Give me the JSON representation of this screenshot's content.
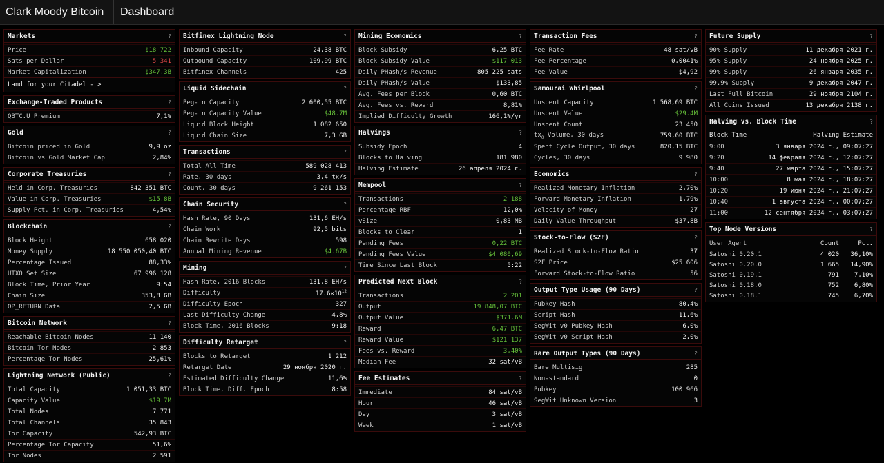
{
  "header": {
    "brand": "Clark Moody Bitcoin",
    "page_title": "Dashboard"
  },
  "columns": [
    [
      {
        "id": "markets",
        "title": "Markets",
        "rows": [
          {
            "k": "Price",
            "v": "$18 722",
            "c": "pos"
          },
          {
            "k": "Sats per Dollar",
            "v": "5 341",
            "c": "neg"
          },
          {
            "k": "Market Capitalization",
            "v": "$347.3B",
            "c": "pos"
          }
        ],
        "link": "Land for your Citadel - >"
      },
      {
        "id": "etp",
        "title": "Exchange-Traded Products",
        "rows": [
          {
            "k": "QBTC.U Premium",
            "v": "7,1%"
          }
        ]
      },
      {
        "id": "gold",
        "title": "Gold",
        "rows": [
          {
            "k": "Bitcoin priced in Gold",
            "v": "9,9 oz"
          },
          {
            "k": "Bitcoin vs Gold Market Cap",
            "v": "2,84%"
          }
        ]
      },
      {
        "id": "corp",
        "title": "Corporate Treasuries",
        "rows": [
          {
            "k": "Held in Corp. Treasuries",
            "v": "842 351 BTC"
          },
          {
            "k": "Value in Corp. Treasuries",
            "v": "$15.8B",
            "c": "pos"
          },
          {
            "k": "Supply Pct. in Corp. Treasuries",
            "v": "4,54%"
          }
        ]
      },
      {
        "id": "blockchain",
        "title": "Blockchain",
        "rows": [
          {
            "k": "Block Height",
            "v": "658 020"
          },
          {
            "k": "Money Supply",
            "v": "18 550 050,40 BTC"
          },
          {
            "k": "Percentage Issued",
            "v": "88,33%"
          },
          {
            "k": "UTXO Set Size",
            "v": "67 996 128"
          },
          {
            "k": "Block Time, Prior Year",
            "v": "9:54"
          },
          {
            "k": "Chain Size",
            "v": "353,8 GB"
          },
          {
            "k": "OP_RETURN Data",
            "v": "2,5 GB"
          }
        ]
      },
      {
        "id": "network",
        "title": "Bitcoin Network",
        "rows": [
          {
            "k": "Reachable Bitcoin Nodes",
            "v": "11 140"
          },
          {
            "k": "Bitcoin Tor Nodes",
            "v": "2 853"
          },
          {
            "k": "Percentage Tor Nodes",
            "v": "25,61%"
          }
        ]
      },
      {
        "id": "lightning",
        "title": "Lightning Network (Public)",
        "rows": [
          {
            "k": "Total Capacity",
            "v": "1 051,33 BTC"
          },
          {
            "k": "Capacity Value",
            "v": "$19.7M",
            "c": "pos"
          },
          {
            "k": "Total Nodes",
            "v": "7 771"
          },
          {
            "k": "Total Channels",
            "v": "35 843"
          },
          {
            "k": "Tor Capacity",
            "v": "542,93 BTC"
          },
          {
            "k": "Percentage Tor Capacity",
            "v": "51,6%"
          },
          {
            "k": "Tor Nodes",
            "v": "2 591"
          }
        ]
      }
    ],
    [
      {
        "id": "bitfinex",
        "title": "Bitfinex Lightning Node",
        "rows": [
          {
            "k": "Inbound Capacity",
            "v": "24,38 BTC"
          },
          {
            "k": "Outbound Capacity",
            "v": "109,99 BTC"
          },
          {
            "k": "Bitfinex Channels",
            "v": "425"
          }
        ]
      },
      {
        "id": "liquid",
        "title": "Liquid Sidechain",
        "rows": [
          {
            "k": "Peg-in Capacity",
            "v": "2 600,55 BTC"
          },
          {
            "k": "Peg-in Capacity Value",
            "v": "$48.7M",
            "c": "pos"
          },
          {
            "k": "Liquid Block Height",
            "v": "1 082 650"
          },
          {
            "k": "Liquid Chain Size",
            "v": "7,3 GB"
          }
        ]
      },
      {
        "id": "transactions",
        "title": "Transactions",
        "rows": [
          {
            "k": "Total All Time",
            "v": "589 028 413"
          },
          {
            "k": "Rate, 30 days",
            "v": "3,4 tx/s"
          },
          {
            "k": "Count, 30 days",
            "v": "9 261 153"
          }
        ]
      },
      {
        "id": "security",
        "title": "Chain Security",
        "rows": [
          {
            "k": "Hash Rate, 90 Days",
            "v": "131,6 EH/s"
          },
          {
            "k": "Chain Work",
            "v": "92,5 bits"
          },
          {
            "k": "Chain Rewrite Days",
            "v": "598"
          },
          {
            "k": "Annual Mining Revenue",
            "v": "$4.67B",
            "c": "pos"
          }
        ]
      },
      {
        "id": "mining",
        "title": "Mining",
        "rows": [
          {
            "k": "Hash Rate, 2016 Blocks",
            "v": "131,8 EH/s"
          },
          {
            "k": "Difficulty",
            "v": "17.6×10",
            "sup": "12"
          },
          {
            "k": "Difficulty Epoch",
            "v": "327"
          },
          {
            "k": "Last Difficulty Change",
            "v": "4,8%"
          },
          {
            "k": "Block Time, 2016 Blocks",
            "v": "9:18"
          }
        ]
      },
      {
        "id": "retarget",
        "title": "Difficulty Retarget",
        "rows": [
          {
            "k": "Blocks to Retarget",
            "v": "1 212"
          },
          {
            "k": "Retarget Date",
            "v": "29 ноября 2020 г."
          },
          {
            "k": "Estimated Difficulty Change",
            "v": "11,6%"
          },
          {
            "k": "Block Time, Diff. Epoch",
            "v": "8:58"
          }
        ]
      }
    ],
    [
      {
        "id": "econ-mining",
        "title": "Mining Economics",
        "rows": [
          {
            "k": "Block Subsidy",
            "v": "6,25 BTC"
          },
          {
            "k": "Block Subsidy Value",
            "v": "$117 013",
            "c": "pos"
          },
          {
            "k": "Daily PHash/s Revenue",
            "v": "805 225 sats"
          },
          {
            "k": "Daily PHash/s Value",
            "v": "$133,85"
          },
          {
            "k": "Avg. Fees per Block",
            "v": "0,60 BTC"
          },
          {
            "k": "Avg. Fees vs. Reward",
            "v": "8,81%"
          },
          {
            "k": "Implied Difficulty Growth",
            "v": "166,1%/yr"
          }
        ]
      },
      {
        "id": "halvings",
        "title": "Halvings",
        "rows": [
          {
            "k": "Subsidy Epoch",
            "v": "4"
          },
          {
            "k": "Blocks to Halving",
            "v": "181 980"
          },
          {
            "k": "Halving Estimate",
            "v": "26 апреля 2024 г."
          }
        ]
      },
      {
        "id": "mempool",
        "title": "Mempool",
        "rows": [
          {
            "k": "Transactions",
            "v": "2 188",
            "c": "pos"
          },
          {
            "k": "Percentage RBF",
            "v": "12,0%"
          },
          {
            "k": "vSize",
            "v": "0,83 MB"
          },
          {
            "k": "Blocks to Clear",
            "v": "1"
          },
          {
            "k": "Pending Fees",
            "v": "0,22 BTC",
            "c": "pos"
          },
          {
            "k": "Pending Fees Value",
            "v": "$4 080,69",
            "c": "pos"
          },
          {
            "k": "Time Since Last Block",
            "v": "5:22"
          }
        ]
      },
      {
        "id": "nextblock",
        "title": "Predicted Next Block",
        "rows": [
          {
            "k": "Transactions",
            "v": "2 201",
            "c": "pos"
          },
          {
            "k": "Output",
            "v": "19 848,07 BTC",
            "c": "pos"
          },
          {
            "k": "Output Value",
            "v": "$371.6M",
            "c": "pos"
          },
          {
            "k": "Reward",
            "v": "6,47 BTC",
            "c": "pos"
          },
          {
            "k": "Reward Value",
            "v": "$121 137",
            "c": "pos"
          },
          {
            "k": "Fees vs. Reward",
            "v": "3,40%",
            "c": "pos"
          },
          {
            "k": "Median Fee",
            "v": "32 sat/vB"
          }
        ]
      },
      {
        "id": "fees-est",
        "title": "Fee Estimates",
        "rows": [
          {
            "k": "Immediate",
            "v": "84 sat/vB"
          },
          {
            "k": "Hour",
            "v": "46 sat/vB"
          },
          {
            "k": "Day",
            "v": "3 sat/vB"
          },
          {
            "k": "Week",
            "v": "1 sat/vB"
          }
        ]
      }
    ],
    [
      {
        "id": "txfees",
        "title": "Transaction Fees",
        "rows": [
          {
            "k": "Fee Rate",
            "v": "48 sat/vB"
          },
          {
            "k": "Fee Percentage",
            "v": "0,0041%"
          },
          {
            "k": "Fee Value",
            "v": "$4,92"
          }
        ]
      },
      {
        "id": "whirlpool",
        "title": "Samourai Whirlpool",
        "rows": [
          {
            "k": "Unspent Capacity",
            "v": "1 568,69 BTC"
          },
          {
            "k": "Unspent Value",
            "v": "$29.4M",
            "c": "pos"
          },
          {
            "k": "Unspent Count",
            "v": "23 450"
          },
          {
            "k": "tx",
            "sub": "0",
            "k2": " Volume, 30 days",
            "v": "759,60 BTC"
          },
          {
            "k": "Spent Cycle Output, 30 days",
            "v": "820,15 BTC"
          },
          {
            "k": "Cycles, 30 days",
            "v": "9 980"
          }
        ]
      },
      {
        "id": "economics",
        "title": "Economics",
        "rows": [
          {
            "k": "Realized Monetary Inflation",
            "v": "2,70%"
          },
          {
            "k": "Forward Monetary Inflation",
            "v": "1,79%"
          },
          {
            "k": "Velocity of Money",
            "v": "27"
          },
          {
            "k": "Daily Value Throughput",
            "v": "$37.8B"
          }
        ]
      },
      {
        "id": "s2f",
        "title": "Stock-to-Flow (S2F)",
        "rows": [
          {
            "k": "Realized Stock-to-Flow Ratio",
            "v": "37"
          },
          {
            "k": "S2F Price",
            "v": "$25 606"
          },
          {
            "k": "Forward Stock-to-Flow Ratio",
            "v": "56"
          }
        ]
      },
      {
        "id": "outputs",
        "title": "Output Type Usage (90 Days)",
        "rows": [
          {
            "k": "Pubkey Hash",
            "v": "80,4%"
          },
          {
            "k": "Script Hash",
            "v": "11,6%"
          },
          {
            "k": "SegWit v0 Pubkey Hash",
            "v": "6,0%"
          },
          {
            "k": "SegWit v0 Script Hash",
            "v": "2,0%"
          }
        ]
      },
      {
        "id": "rare",
        "title": "Rare Output Types (90 Days)",
        "rows": [
          {
            "k": "Bare Multisig",
            "v": "285"
          },
          {
            "k": "Non-standard",
            "v": "0"
          },
          {
            "k": "Pubkey",
            "v": "100 966"
          },
          {
            "k": "SegWit Unknown Version",
            "v": "3"
          }
        ]
      }
    ],
    [
      {
        "id": "future",
        "title": "Future Supply",
        "rows": [
          {
            "k": "90% Supply",
            "v": "11 декабря 2021 г."
          },
          {
            "k": "95% Supply",
            "v": "24 ноября 2025 г."
          },
          {
            "k": "99% Supply",
            "v": "26 января 2035 г."
          },
          {
            "k": "99.9% Supply",
            "v": "9 декабря 2047 г."
          },
          {
            "k": "Last Full Bitcoin",
            "v": "29 ноября 2104 г."
          },
          {
            "k": "All Coins Issued",
            "v": "13 декабря 2138 г."
          }
        ]
      },
      {
        "id": "halving-bt",
        "title": "Halving vs. Block Time",
        "table": {
          "headers": [
            "Block Time",
            "Halving Estimate"
          ],
          "rows": [
            [
              "9:00",
              "3 января 2024 г., 09:07:27"
            ],
            [
              "9:20",
              "14 февраля 2024 г., 12:07:27"
            ],
            [
              "9:40",
              "27 марта 2024 г., 15:07:27"
            ],
            [
              "10:00",
              "8 мая 2024 г., 18:07:27"
            ],
            [
              "10:20",
              "19 июня 2024 г., 21:07:27"
            ],
            [
              "10:40",
              "1 августа 2024 г., 00:07:27"
            ],
            [
              "11:00",
              "12 сентября 2024 г., 03:07:27"
            ]
          ]
        }
      },
      {
        "id": "versions",
        "title": "Top Node Versions",
        "table3": {
          "headers": [
            "User Agent",
            "Count",
            "Pct."
          ],
          "rows": [
            [
              "Satoshi 0.20.1",
              "4 020",
              "36,10%"
            ],
            [
              "Satoshi 0.20.0",
              "1 665",
              "14,90%"
            ],
            [
              "Satoshi 0.19.1",
              "791",
              "7,10%"
            ],
            [
              "Satoshi 0.18.0",
              "752",
              "6,80%"
            ],
            [
              "Satoshi 0.18.1",
              "745",
              "6,70%"
            ]
          ]
        }
      }
    ]
  ],
  "help_glyph": "?",
  "colors": {
    "positive": "#67c23a",
    "negative": "#e04848",
    "border": "#3a0b0b"
  }
}
